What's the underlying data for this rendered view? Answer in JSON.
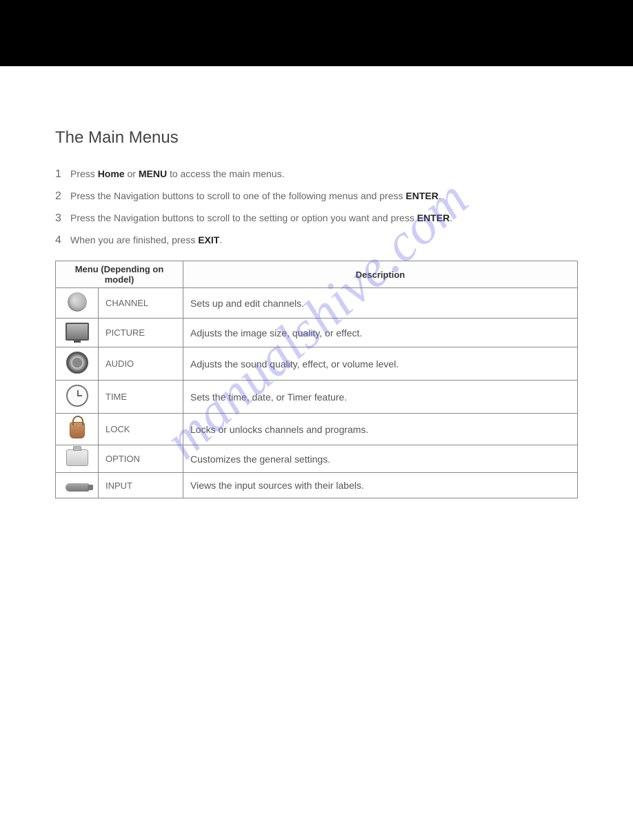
{
  "title": "The Main Menus",
  "watermark": "manualshive.com",
  "steps": [
    {
      "num": "1",
      "html": "Press <b>Home</b> or <b>MENU</b> to access the main menus."
    },
    {
      "num": "2",
      "html": "Press the Navigation buttons to scroll to one of the following menus and press <b>ENTER</b>."
    },
    {
      "num": "3",
      "html": "Press the Navigation buttons to scroll to the setting or option you want and press <b>ENTER</b>."
    },
    {
      "num": "4",
      "html": "When you are finished, press <b>EXIT</b>."
    }
  ],
  "table": {
    "header_menu": "Menu (Depending on model)",
    "header_desc": "Description",
    "rows": [
      {
        "icon": "channel",
        "name": "CHANNEL",
        "desc": "Sets up and edit channels."
      },
      {
        "icon": "picture",
        "name": "PICTURE",
        "desc": "Adjusts the image size, quality, or effect."
      },
      {
        "icon": "audio",
        "name": "AUDIO",
        "desc": "Adjusts the sound quality, effect, or volume level."
      },
      {
        "icon": "time",
        "name": "TIME",
        "desc": "Sets the time, date, or Timer feature."
      },
      {
        "icon": "lock",
        "name": "LOCK",
        "desc": "Locks or unlocks channels and programs."
      },
      {
        "icon": "option",
        "name": "OPTION",
        "desc": "Customizes the general settings."
      },
      {
        "icon": "input",
        "name": "INPUT",
        "desc": "Views the input sources with their labels."
      }
    ]
  }
}
